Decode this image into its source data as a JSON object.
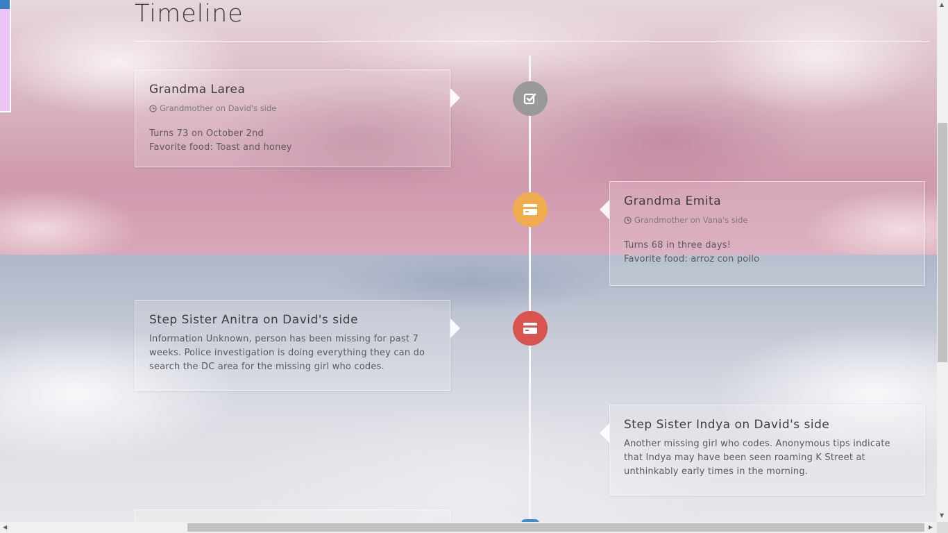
{
  "page": {
    "title": "Timeline"
  },
  "timeline": {
    "entries": [
      {
        "side": "left",
        "title": "Grandma Larea",
        "subtitle": "Grandmother on David's side",
        "body": [
          "Turns 73 on October 2nd",
          "Favorite food: Toast and honey"
        ],
        "badge_icon": "check-square-icon",
        "badge_color": "#999999"
      },
      {
        "side": "right",
        "title": "Grandma Emita",
        "subtitle": "Grandmother on Vana's side",
        "body": [
          "Turns 68 in three days!",
          "Favorite food: arroz con pollo"
        ],
        "badge_icon": "credit-card-icon",
        "badge_color": "#f0ad4e"
      },
      {
        "side": "left",
        "title": "Step Sister Anitra on David's side",
        "body": [
          "Information Unknown, person has been missing for past 7 weeks. Police investigation is doing everything they can do search the DC area for the missing girl who codes."
        ],
        "badge_icon": "credit-card-icon",
        "badge_color": "#d9534f"
      },
      {
        "side": "right",
        "title": "Step Sister Indya on David's side",
        "body": [
          "Another missing girl who codes. Anonymous tips indicate that Indya may have been seen roaming K Street at unthinkably early times in the morning."
        ]
      }
    ]
  },
  "colors": {
    "timeline_line": "#f7f7f7",
    "next_badge_peek": "#3a8fd0"
  }
}
